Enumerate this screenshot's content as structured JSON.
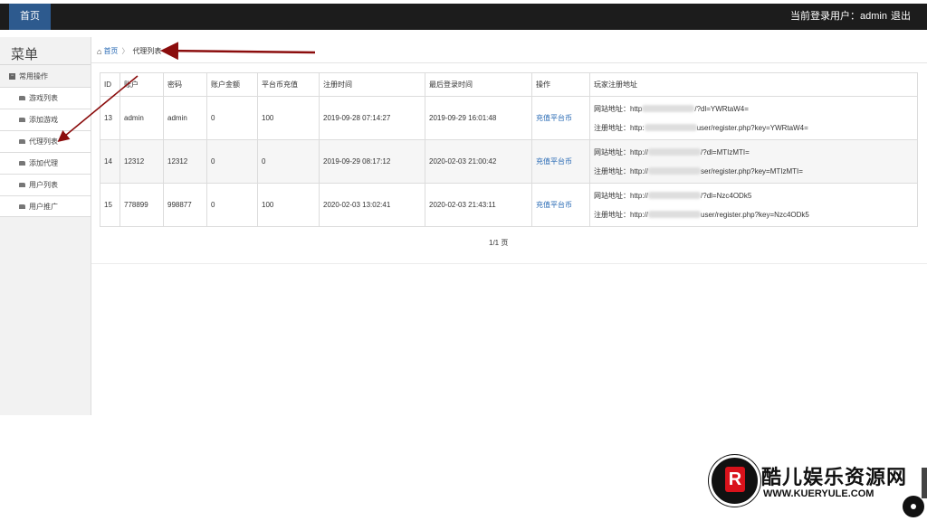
{
  "topbar": {
    "home_tab": "首页",
    "user_info": "当前登录用户：admin",
    "logout": "退出"
  },
  "sidebar": {
    "title": "菜单",
    "group_label": "常用操作",
    "items": [
      {
        "label": "游戏列表"
      },
      {
        "label": "添加游戏"
      },
      {
        "label": "代理列表"
      },
      {
        "label": "添加代理"
      },
      {
        "label": "用户列表"
      },
      {
        "label": "用户推广"
      }
    ]
  },
  "breadcrumb": {
    "home": "首页",
    "separator": "〉",
    "current": "代理列表"
  },
  "table": {
    "headers": [
      "ID",
      "账户",
      "密码",
      "账户金额",
      "平台币充值",
      "注册时间",
      "最后登录时间",
      "操作",
      "玩家注册地址"
    ],
    "rows": [
      {
        "id": "13",
        "account": "admin",
        "password": "admin",
        "balance": "0",
        "recharge": "100",
        "reg_time": "2019-09-28 07:14:27",
        "last_login": "2019-09-29 16:01:48",
        "action": "充值平台币",
        "site_prefix": "网站地址：http",
        "site_suffix": "/?dl=YWRtaW4=",
        "reg_prefix": "注册地址：http:",
        "reg_suffix": "user/register.php?key=YWRtaW4="
      },
      {
        "id": "14",
        "account": "12312",
        "password": "12312",
        "balance": "0",
        "recharge": "0",
        "reg_time": "2019-09-29 08:17:12",
        "last_login": "2020-02-03 21:00:42",
        "action": "充值平台币",
        "site_prefix": "网站地址：http://",
        "site_suffix": "/?dl=MTIzMTI=",
        "reg_prefix": "注册地址：http://",
        "reg_suffix": "ser/register.php?key=MTIzMTI="
      },
      {
        "id": "15",
        "account": "778899",
        "password": "998877",
        "balance": "0",
        "recharge": "100",
        "reg_time": "2020-02-03 13:02:41",
        "last_login": "2020-02-03 21:43:11",
        "action": "充值平台币",
        "site_prefix": "网站地址：http://",
        "site_suffix": "/?dl=Nzc4ODk5",
        "reg_prefix": "注册地址：http://",
        "reg_suffix": "user/register.php?key=Nzc4ODk5"
      }
    ]
  },
  "pager": "1/1 页",
  "watermark": {
    "title": "酷儿娱乐资源网",
    "url": "WWW.KUERYULE.COM",
    "badge": "R"
  },
  "colors": {
    "topbar_bg": "#1c1c1c",
    "home_tab_bg": "#2d5a8e",
    "link": "#2a6bb5",
    "annotation_arrow": "#8b0d0d"
  }
}
